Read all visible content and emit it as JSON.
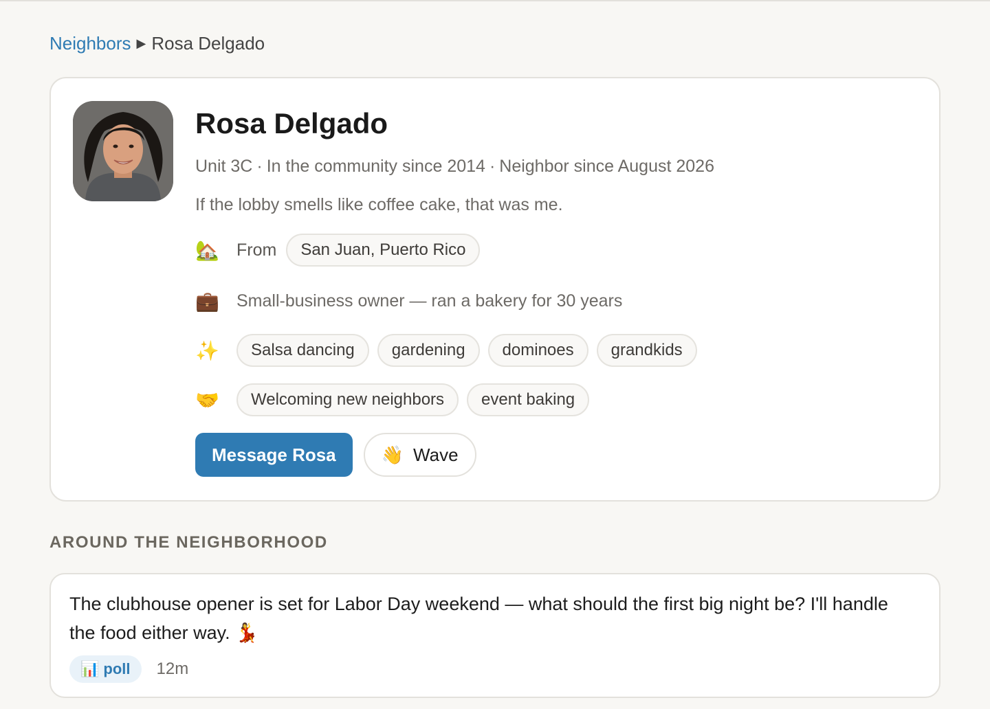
{
  "breadcrumb": {
    "parent": "Neighbors",
    "separator": "▶",
    "current": "Rosa Delgado"
  },
  "profile": {
    "name": "Rosa Delgado",
    "meta": {
      "unit": "Unit 3C",
      "community": "In the community since 2014",
      "neighbor": "Neighbor since August 2026",
      "separator": "·"
    },
    "bio": "If the lobby smells like coffee cake, that was me.",
    "from": {
      "icon": "house-with-garden-icon",
      "label": "From",
      "value": "San Juan, Puerto Rico"
    },
    "occupation": {
      "icon": "briefcase-icon",
      "text": "Small-business owner — ran a bakery for 30 years"
    },
    "interests": {
      "icon": "sparkles-icon",
      "items": [
        "Salsa dancing",
        "gardening",
        "dominoes",
        "grandkids"
      ]
    },
    "helps_with": {
      "icon": "handshake-icon",
      "items": [
        "Welcoming new neighbors",
        "event baking"
      ]
    },
    "actions": {
      "message_label": "Message Rosa",
      "wave_label": "Wave",
      "wave_icon": "waving-hand-icon"
    }
  },
  "section": {
    "heading": "AROUND THE NEIGHBORHOOD"
  },
  "post": {
    "text": "The clubhouse opener is set for Labor Day weekend — what should the first big night be? I'll handle the food either way. 💃",
    "badge_icon": "bar-chart-icon",
    "badge_label": "poll",
    "time": "12m"
  },
  "colors": {
    "accent": "#2f7bb3",
    "background": "#f8f7f4",
    "muted_text": "#6d6a66"
  }
}
